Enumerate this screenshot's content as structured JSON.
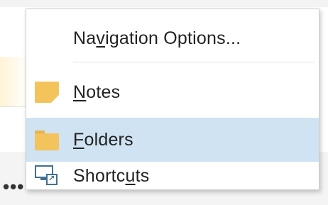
{
  "menu": {
    "header": {
      "label_pre": "Na",
      "label_ul": "v",
      "label_post": "igation Options..."
    },
    "items": [
      {
        "id": "notes",
        "icon": "notes-icon",
        "label_pre": "",
        "label_ul": "N",
        "label_post": "otes",
        "selected": false
      },
      {
        "id": "folders",
        "icon": "folder-icon",
        "label_pre": "",
        "label_ul": "F",
        "label_post": "olders",
        "selected": true
      },
      {
        "id": "shortcuts",
        "icon": "shortcuts-icon",
        "label_pre": "Shortc",
        "label_ul": "u",
        "label_post": "ts",
        "selected": false
      }
    ]
  },
  "background": {
    "more_indicator": "•••"
  },
  "colors": {
    "selection": "#cfe3f2",
    "icon_yellow": "#f2c45b",
    "icon_blue": "#3f6f94"
  }
}
